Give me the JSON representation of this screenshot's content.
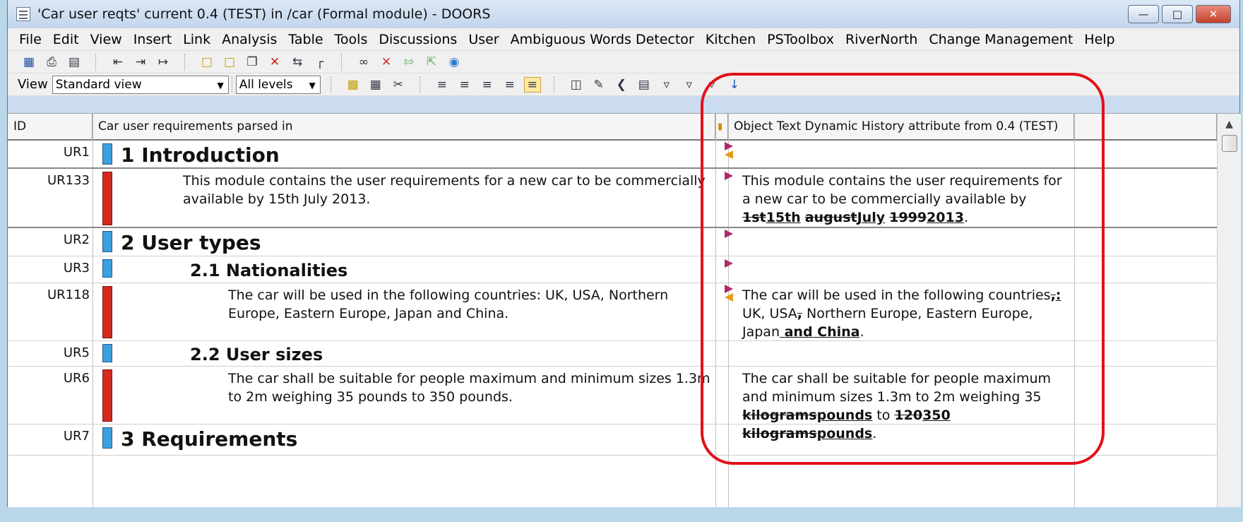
{
  "window": {
    "title": "'Car user reqts' current 0.4 (TEST) in /car (Formal module) - DOORS",
    "controls": [
      "minimize",
      "maximize",
      "close"
    ]
  },
  "menu": [
    "File",
    "Edit",
    "View",
    "Insert",
    "Link",
    "Analysis",
    "Table",
    "Tools",
    "Discussions",
    "User",
    "Ambiguous Words Detector",
    "Kitchen",
    "PSToolbox",
    "RiverNorth",
    "Change Management",
    "Help"
  ],
  "toolbar2": {
    "view_label": "View",
    "view_value": "Standard view",
    "levels_value": "All levels"
  },
  "columns": {
    "id": "ID",
    "main": "Car user requirements parsed in",
    "history": "Object Text Dynamic History attribute from 0.4 (TEST)"
  },
  "rows": [
    {
      "id": "UR1",
      "type": "heading",
      "number": "1",
      "title": "Introduction"
    },
    {
      "id": "UR133",
      "type": "text",
      "text": "This module contains the user requirements for a new car to be commercially available by 15th July 2013.",
      "history": {
        "plain1": "This module contains the user requirements for a new car to be commercially available by ",
        "del1": "1st",
        "ins1": "15th",
        "del2": "august",
        "ins2": "July",
        "plain2": " ",
        "del3": "1999",
        "ins3": "2013",
        "plain3": "."
      }
    },
    {
      "id": "UR2",
      "type": "heading",
      "number": "2",
      "title": "User types"
    },
    {
      "id": "UR3",
      "type": "heading",
      "number": "2.1",
      "title": "Nationalities"
    },
    {
      "id": "UR118",
      "type": "text",
      "text": "The car will be used in the following countries: UK, USA, Northern Europe, Eastern Europe, Japan and China.",
      "history": {
        "plain1": "The car will be used in the following countries",
        "del1": ",",
        "ins1": ":",
        "plain2": " UK, USA",
        "del2": ",",
        "plain3": " Northern Europe, Eastern Europe, Japan",
        "ins2": " and China",
        "plain4": "."
      }
    },
    {
      "id": "UR5",
      "type": "heading",
      "number": "2.2",
      "title": "User sizes"
    },
    {
      "id": "UR6",
      "type": "text",
      "text": "The car shall be suitable for people maximum and minimum sizes 1.3m to 2m weighing 35 pounds to 350 pounds.",
      "history": {
        "plain1": "The car shall be suitable for people maximum and minimum sizes 1.3m to 2m weighing 35 ",
        "del1": "kilograms",
        "ins1": "pounds",
        "plain2": " to ",
        "del2": "120",
        "ins2": "350",
        "plain3": " ",
        "del3": "kilograms",
        "ins3": "pounds",
        "plain4": "."
      }
    },
    {
      "id": "UR7",
      "type": "heading",
      "number": "3",
      "title": "Requirements"
    }
  ]
}
